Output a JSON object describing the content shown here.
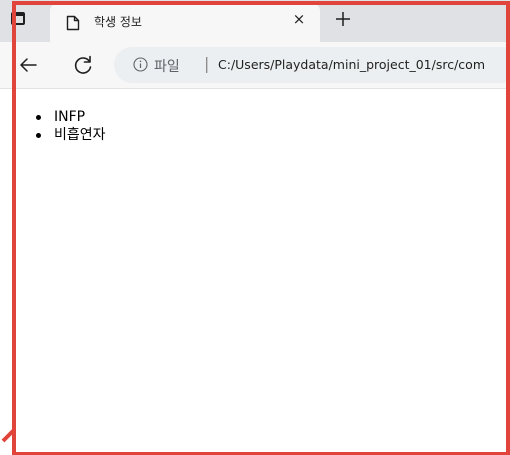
{
  "browser": {
    "tab": {
      "title": "학생 정보",
      "close_label": "×",
      "favicon": "page-icon"
    },
    "new_tab": {
      "icon": "plus-icon"
    },
    "toolbar": {
      "back_icon": "arrow-left-icon",
      "reload_icon": "reload-icon",
      "site_info_icon": "info-icon",
      "site_label": "파일",
      "separator": "|",
      "url": "C:/Users/Playdata/mini_project_01/src/com"
    }
  },
  "page": {
    "list": [
      {
        "text": "INFP"
      },
      {
        "text": "비흡연자"
      }
    ]
  },
  "annotation": {
    "frame_color": "#e0443a"
  }
}
